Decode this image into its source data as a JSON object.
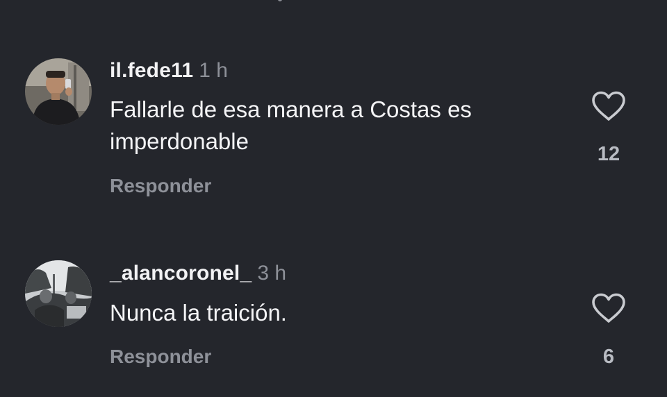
{
  "comments": [
    {
      "username": "il.fede11",
      "time": "1 h",
      "text": "Fallarle de esa manera a Costas es imperdonable",
      "reply_label": "Responder",
      "likes": "12",
      "avatar_icon": "profile-photo-mirror-selfie",
      "like_icon": "heart-outline-icon"
    },
    {
      "username": "_alancoronel_",
      "time": "3 h",
      "text": "Nunca la traición.",
      "reply_label": "Responder",
      "likes": "6",
      "avatar_icon": "profile-photo-outdoor-group",
      "like_icon": "heart-outline-icon"
    }
  ],
  "colors": {
    "background": "#24262c",
    "primary_text": "#f2f2f4",
    "secondary_text": "#8e9199",
    "like_count": "#b8bbc2",
    "heart_outline": "#c9cbd0"
  }
}
